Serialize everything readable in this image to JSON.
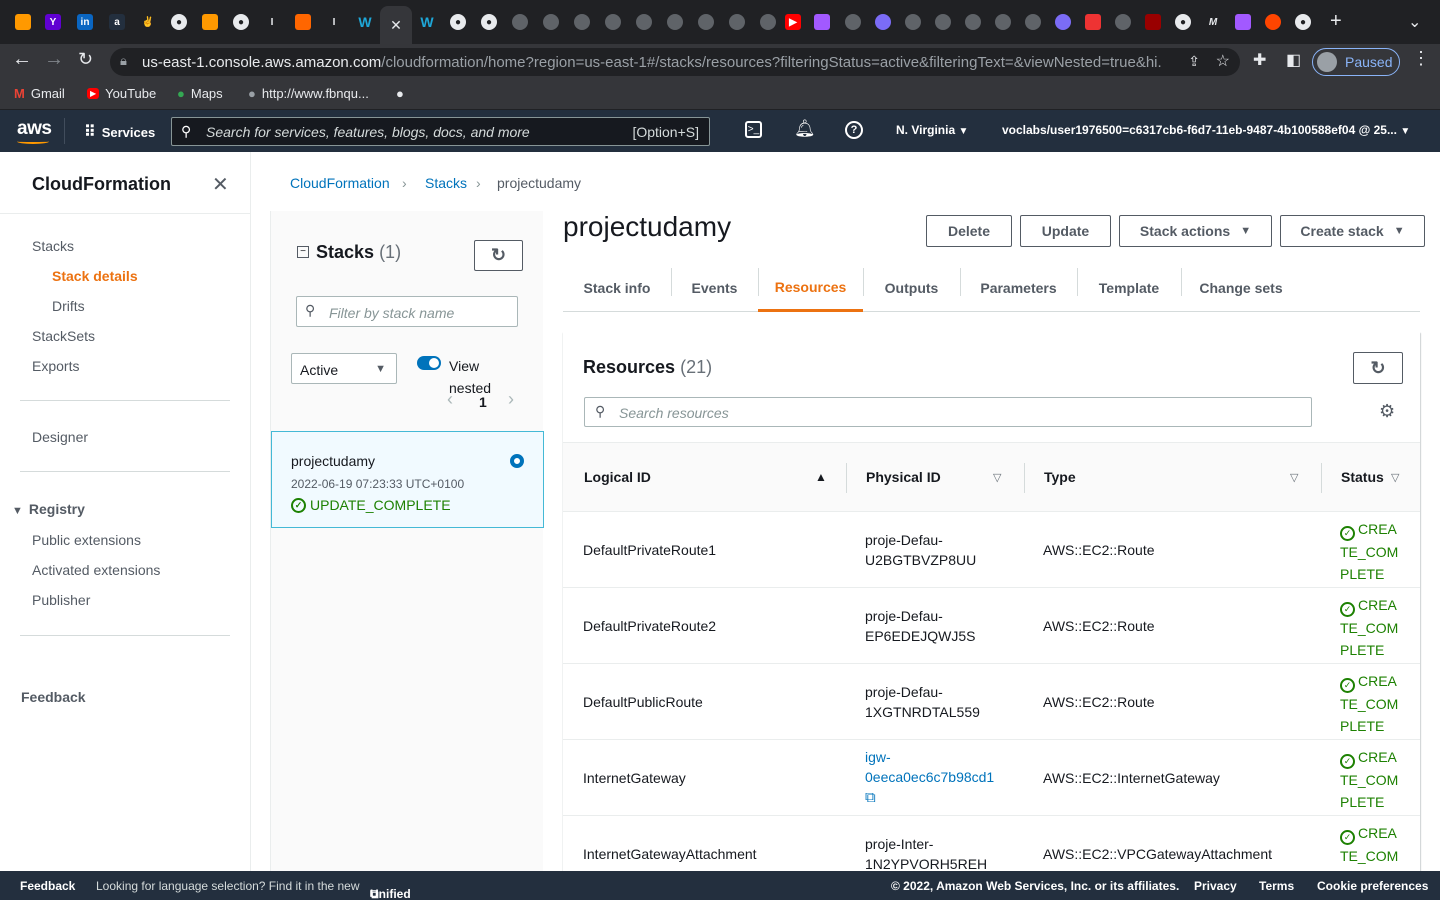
{
  "browser": {
    "url_host": "us-east-1.console.aws.amazon.com",
    "url_path": "/cloudformation/home?region=us-east-1#/stacks/resources?filteringStatus=active&filteringText=&viewNested=true&hi...",
    "profile_label": "Paused",
    "bookmarks": [
      {
        "label": "Gmail"
      },
      {
        "label": "YouTube"
      },
      {
        "label": "Maps"
      },
      {
        "label": "http://www.fbnqu..."
      }
    ]
  },
  "aws_bar": {
    "logo": "aws",
    "services_label": "Services",
    "search_placeholder": "Search for services, features, blogs, docs, and more",
    "search_shortcut": "[Option+S]",
    "region": "N. Virginia",
    "account": "voclabs/user1976500=c6317cb6-f6d7-11eb-9487-4b100588ef04 @ 25..."
  },
  "sidebar": {
    "title": "CloudFormation",
    "items": {
      "stacks": "Stacks",
      "stack_details": "Stack details",
      "drifts": "Drifts",
      "stacksets": "StackSets",
      "exports": "Exports",
      "designer": "Designer",
      "registry": "Registry",
      "public_extensions": "Public extensions",
      "activated_extensions": "Activated extensions",
      "publisher": "Publisher",
      "feedback": "Feedback"
    }
  },
  "breadcrumb": {
    "c1": "CloudFormation",
    "c2": "Stacks",
    "c3": "projectudamy"
  },
  "stacks_panel": {
    "title": "Stacks",
    "count": "(1)",
    "filter_placeholder": "Filter by stack name",
    "status_filter": "Active",
    "view_nested_1": "View",
    "view_nested_2": "nested",
    "page": "1",
    "stack": {
      "name": "projectudamy",
      "timestamp": "2022-06-19 07:23:33 UTC+0100",
      "status": "UPDATE_COMPLETE"
    }
  },
  "stack": {
    "title": "projectudamy",
    "buttons": {
      "delete": "Delete",
      "update": "Update",
      "actions": "Stack actions",
      "create": "Create stack"
    },
    "tabs": [
      "Stack info",
      "Events",
      "Resources",
      "Outputs",
      "Parameters",
      "Template",
      "Change sets"
    ]
  },
  "resources": {
    "title": "Resources",
    "count": "(21)",
    "search_placeholder": "Search resources",
    "columns": {
      "logical": "Logical ID",
      "physical": "Physical ID",
      "type": "Type",
      "status": "Status"
    },
    "rows": [
      {
        "logical": "DefaultPrivateRoute1",
        "physical1": "proje-Defau-",
        "physical2": "U2BGTBVZP8UU",
        "type": "AWS::EC2::Route",
        "status": "CREATE_COMPLETE"
      },
      {
        "logical": "DefaultPrivateRoute2",
        "physical1": "proje-Defau-",
        "physical2": "EP6EDEJQWJ5S",
        "type": "AWS::EC2::Route",
        "status": "CREATE_COMPLETE"
      },
      {
        "logical": "DefaultPublicRoute",
        "physical1": "proje-Defau-",
        "physical2": "1XGTNRDTAL559",
        "type": "AWS::EC2::Route",
        "status": "CREATE_COMPLETE"
      },
      {
        "logical": "InternetGateway",
        "physical1": "igw-",
        "physical2": "0eeca0ec6c7b98cd1",
        "type": "AWS::EC2::InternetGateway",
        "status": "CREATE_COMPLETE"
      },
      {
        "logical": "InternetGatewayAttachment",
        "physical1": "proje-Inter-",
        "physical2": "1N2YPVORH5REH",
        "type": "AWS::EC2::VPCGatewayAttachment",
        "status": "CREATE_COMPLETE"
      }
    ]
  },
  "footer": {
    "feedback": "Feedback",
    "language_text": "Looking for language selection? Find it in the new",
    "unified": "Unified Settings",
    "copyright": "© 2022, Amazon Web Services, Inc. or its affiliates.",
    "privacy": "Privacy",
    "terms": "Terms",
    "cookies": "Cookie preferences"
  },
  "colors": {
    "aws_navy": "#232f3e",
    "accent_orange": "#ec7211",
    "link_blue": "#0073bb",
    "success_green": "#1d8102"
  }
}
